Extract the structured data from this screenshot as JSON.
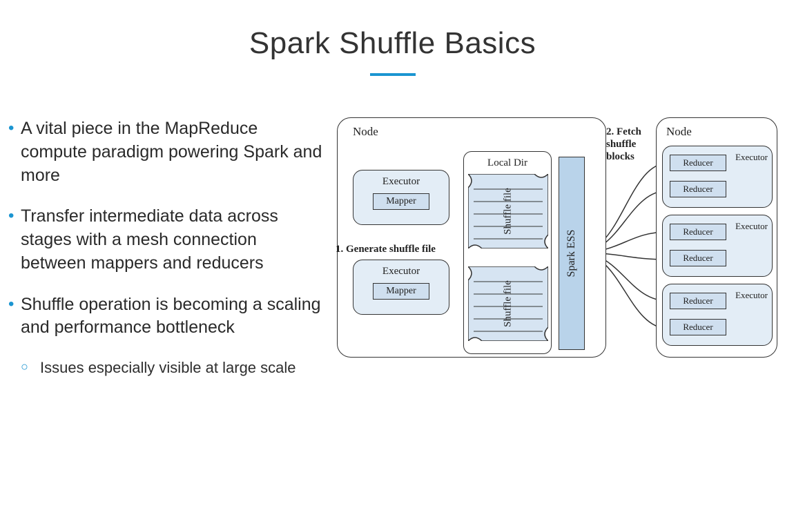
{
  "title": "Spark Shuffle Basics",
  "bullets": [
    "A vital piece in the MapReduce compute paradigm powering Spark and more",
    "Transfer intermediate data across stages with a mesh connection between mappers and reducers",
    "Shuffle operation is becoming a scaling and performance bottleneck"
  ],
  "sub_bullet": "Issues especially visible at large scale",
  "diagram": {
    "node_left_label": "Node",
    "node_right_label": "Node",
    "executor_label": "Executor",
    "mapper_label": "Mapper",
    "reducer_label": "Reducer",
    "local_dir_label": "Local Dir",
    "shuffle_file_label": "Shuffle file",
    "spark_ess_label": "Spark ESS",
    "caption_generate": "1. Generate shuffle file",
    "caption_fetch": "2. Fetch shuffle blocks"
  }
}
